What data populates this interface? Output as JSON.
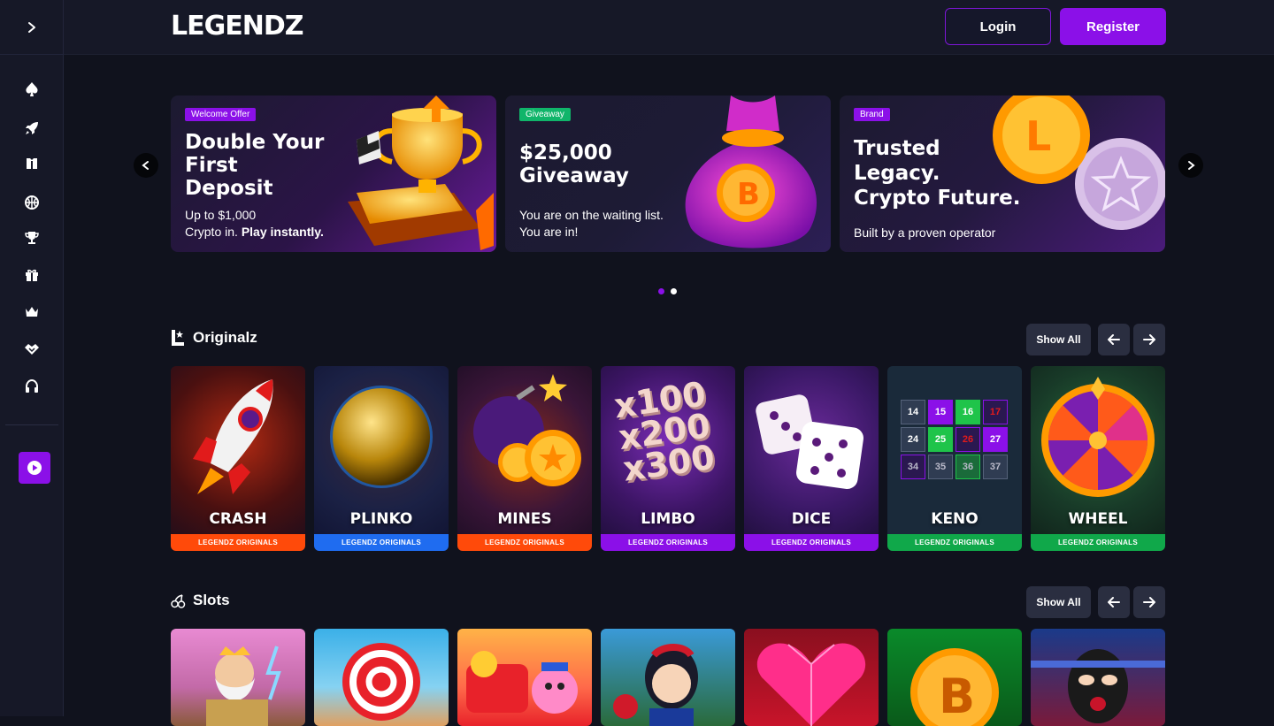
{
  "brand": {
    "logo": "LEGENDZ"
  },
  "header": {
    "login_label": "Login",
    "register_label": "Register"
  },
  "sidebar": {
    "items": [
      {
        "icon": "spade-icon"
      },
      {
        "icon": "rocket-icon"
      },
      {
        "icon": "ticket-icon"
      },
      {
        "icon": "basketball-icon"
      },
      {
        "icon": "trophy-icon"
      },
      {
        "icon": "gift-icon"
      },
      {
        "icon": "crown-icon"
      },
      {
        "icon": "handshake-icon"
      },
      {
        "icon": "headset-icon"
      }
    ],
    "live_icon": "play-icon"
  },
  "banners": [
    {
      "tag": "Welcome Offer",
      "tag_color": "#8b10e8",
      "title_lines": [
        "Double Your",
        "First",
        "Deposit"
      ],
      "sub_line1": "Up to $1,000",
      "sub_line2_prefix": "Crypto in. ",
      "sub_line2_bold": "Play instantly."
    },
    {
      "tag": "Giveaway",
      "tag_color": "#10b56a",
      "title_lines": [
        "$25,000",
        "Giveaway"
      ],
      "sub_line1": "You are on the waiting list.",
      "sub_line2": "You are in!"
    },
    {
      "tag": "Brand",
      "tag_color": "#8b10e8",
      "title_lines": [
        "Trusted",
        "Legacy.",
        "Crypto Future."
      ],
      "sub_line1": "Built by a proven operator"
    }
  ],
  "carousel": {
    "pages": 2,
    "active": 0
  },
  "originalz": {
    "title": "Originalz",
    "show_all": "Show All",
    "games": [
      {
        "name": "CRASH",
        "strip": "LEGENDZ ORIGINALS",
        "strip_color": "#ff4a0a"
      },
      {
        "name": "PLINKO",
        "strip": "LEGENDZ ORIGINALS",
        "strip_color": "#1f6cf0"
      },
      {
        "name": "MINES",
        "strip": "LEGENDZ ORIGINALS",
        "strip_color": "#ff4a0a"
      },
      {
        "name": "LIMBO",
        "strip": "LEGENDZ ORIGINALS",
        "strip_color": "#8b10e8"
      },
      {
        "name": "DICE",
        "strip": "LEGENDZ ORIGINALS",
        "strip_color": "#8b10e8"
      },
      {
        "name": "KENO",
        "strip": "LEGENDZ ORIGINALS",
        "strip_color": "#10a84a"
      },
      {
        "name": "WHEEL",
        "strip": "LEGENDZ ORIGINALS",
        "strip_color": "#10a84a"
      }
    ],
    "limbo_art": [
      "x100",
      "x200",
      "x300"
    ],
    "keno_grid": [
      "14",
      "15",
      "16",
      "17",
      "24",
      "25",
      "26",
      "27",
      "34",
      "35",
      "36",
      "37"
    ]
  },
  "slots": {
    "title": "Slots",
    "show_all": "Show All"
  }
}
